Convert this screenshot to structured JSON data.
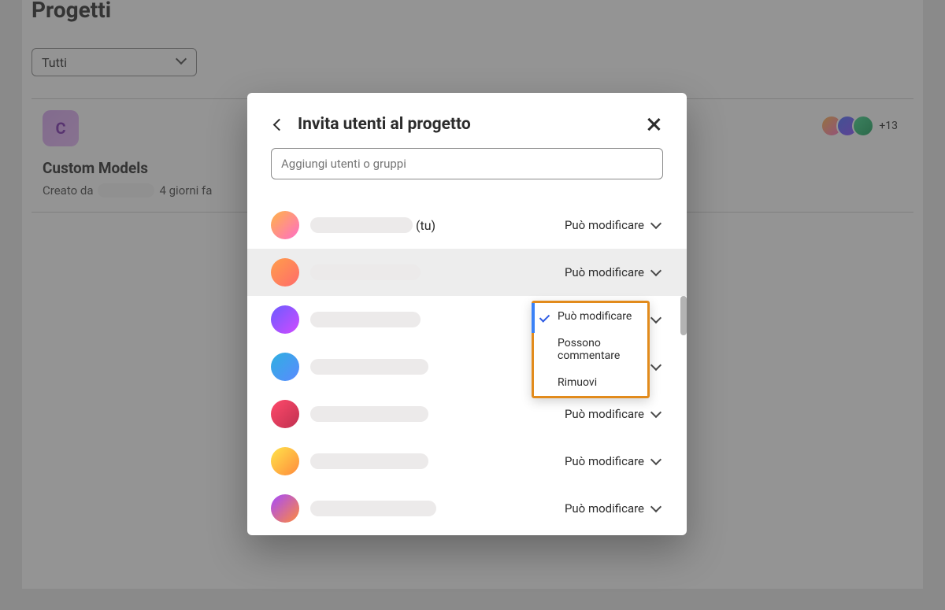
{
  "page": {
    "title": "Progetti",
    "filter_label": "Tutti"
  },
  "project_card": {
    "thumb_letter": "C",
    "more_avatars": "+13",
    "title": "Custom Models",
    "created_by_prefix": "Creato da",
    "created_time": "4 giorni fa"
  },
  "modal": {
    "title": "Invita utenti al progetto",
    "input_placeholder": "Aggiungi utenti o gruppi",
    "you_suffix": "(tu)"
  },
  "permission_label": "Può modificare",
  "users": [
    {
      "avatar_class": "ua1",
      "name_redact_width": 130,
      "is_you": true,
      "permission": "Può modificare",
      "highlight": false
    },
    {
      "avatar_class": "ua2",
      "name_redact_width": 140,
      "is_you": false,
      "permission": "Può modificare",
      "highlight": true,
      "dropdown_open": true
    },
    {
      "avatar_class": "ua3",
      "name_redact_width": 140,
      "is_you": false,
      "permission": "Può modificare",
      "highlight": false
    },
    {
      "avatar_class": "ua4",
      "name_redact_width": 150,
      "is_you": false,
      "permission": "Può modificare",
      "highlight": false
    },
    {
      "avatar_class": "ua5",
      "name_redact_width": 150,
      "is_you": false,
      "permission": "Può modificare",
      "highlight": false
    },
    {
      "avatar_class": "ua6",
      "name_redact_width": 150,
      "is_you": false,
      "permission": "Può modificare",
      "highlight": false
    },
    {
      "avatar_class": "ua7",
      "name_redact_width": 160,
      "is_you": false,
      "permission": "Può modificare",
      "highlight": false
    }
  ],
  "dropdown": {
    "options": [
      {
        "label": "Può modificare",
        "checked": true
      },
      {
        "label": "Possono commentare",
        "checked": false
      },
      {
        "label": "Rimuovi",
        "checked": false
      }
    ]
  }
}
